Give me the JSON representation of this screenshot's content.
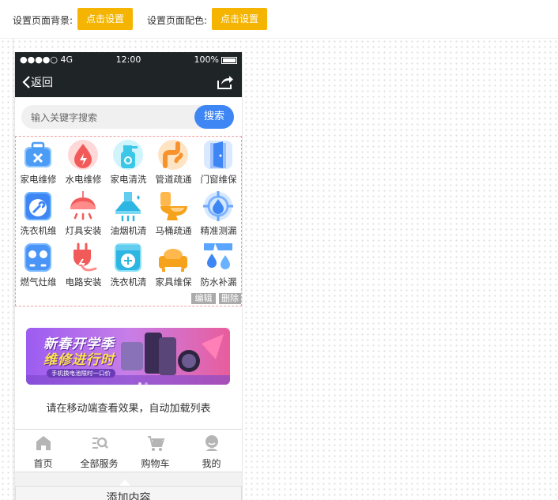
{
  "toolbar": {
    "bg_label": "设置页面背景:",
    "bg_button": "点击设置",
    "color_label": "设置页面配色:",
    "color_button": "点击设置",
    "accent": "#f5b400"
  },
  "status": {
    "signal": "●●●●○ 4G",
    "time": "12:00",
    "battery": "100%"
  },
  "nav": {
    "back": "返回"
  },
  "search": {
    "placeholder": "输入关键字搜索",
    "button": "搜索",
    "accent": "#3f86f5"
  },
  "grid": {
    "items": [
      {
        "label": "家电维修",
        "icon": "toolbox-icon"
      },
      {
        "label": "水电维修",
        "icon": "water-drop-icon"
      },
      {
        "label": "家电清洗",
        "icon": "spray-bottle-icon"
      },
      {
        "label": "管道疏通",
        "icon": "pipe-icon"
      },
      {
        "label": "门窗维保",
        "icon": "door-icon"
      },
      {
        "label": "洗衣机维",
        "icon": "washing-machine-icon"
      },
      {
        "label": "灯具安装",
        "icon": "lamp-icon"
      },
      {
        "label": "油烟机清",
        "icon": "range-hood-icon"
      },
      {
        "label": "马桶疏通",
        "icon": "toilet-icon"
      },
      {
        "label": "精准测漏",
        "icon": "target-drop-icon"
      },
      {
        "label": "燃气灶维",
        "icon": "gas-stove-icon"
      },
      {
        "label": "电路安装",
        "icon": "plug-icon"
      },
      {
        "label": "洗衣机清",
        "icon": "washer-clean-icon"
      },
      {
        "label": "家具维保",
        "icon": "sofa-icon"
      },
      {
        "label": "防水补漏",
        "icon": "leak-icon"
      }
    ],
    "edit": "编辑",
    "delete": "删除"
  },
  "banner": {
    "headline1": "新春开学季",
    "headline2": "维修进行时",
    "sub": "手机换电池限时一口价"
  },
  "tip": "请在移动端查看效果，自动加载列表",
  "tabs": [
    {
      "label": "首页",
      "icon": "home-icon"
    },
    {
      "label": "全部服务",
      "icon": "service-list-icon"
    },
    {
      "label": "购物车",
      "icon": "cart-icon"
    },
    {
      "label": "我的",
      "icon": "user-icon"
    }
  ],
  "add_content": "添加内容"
}
